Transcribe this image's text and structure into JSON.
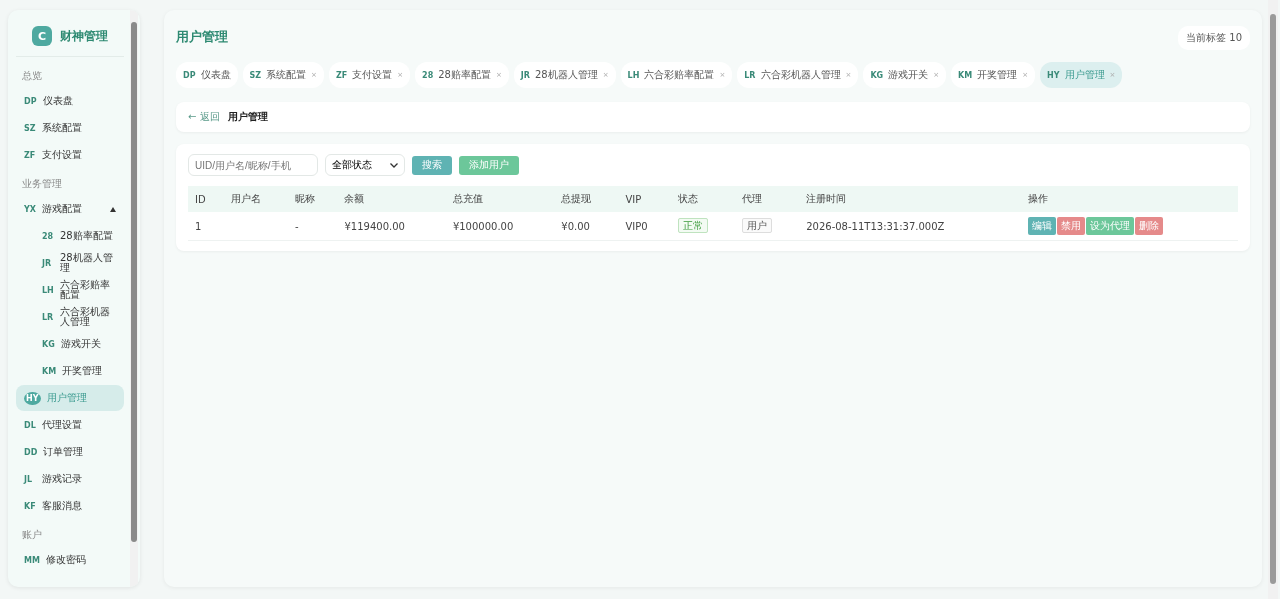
{
  "sidebar": {
    "logo_letter": "C",
    "brand": "财神管理",
    "sections": [
      {
        "title": "总览",
        "items": [
          {
            "code": "DP",
            "label": "仪表盘",
            "selected": false
          },
          {
            "code": "SZ",
            "label": "系统配置",
            "selected": false
          },
          {
            "code": "ZF",
            "label": "支付设置",
            "selected": false
          }
        ]
      },
      {
        "title": "业务管理",
        "items": [
          {
            "code": "YX",
            "label": "游戏配置",
            "selected": false,
            "expanded": true,
            "children": [
              {
                "code": "28",
                "label": "28赔率配置",
                "selected": false
              },
              {
                "code": "JR",
                "label": "28机器人管理",
                "selected": false
              },
              {
                "code": "LH",
                "label": "六合彩赔率配置",
                "selected": false
              },
              {
                "code": "LR",
                "label": "六合彩机器人管理",
                "selected": false
              },
              {
                "code": "KG",
                "label": "游戏开关",
                "selected": false
              },
              {
                "code": "KM",
                "label": "开奖管理",
                "selected": false
              }
            ]
          },
          {
            "code": "HY",
            "label": "用户管理",
            "selected": true
          },
          {
            "code": "DL",
            "label": "代理设置",
            "selected": false
          },
          {
            "code": "DD",
            "label": "订单管理",
            "selected": false
          },
          {
            "code": "JL",
            "label": "游戏记录",
            "selected": false
          },
          {
            "code": "KF",
            "label": "客服消息",
            "selected": false
          }
        ]
      },
      {
        "title": "账户",
        "items": [
          {
            "code": "MM",
            "label": "修改密码",
            "selected": false
          }
        ]
      }
    ]
  },
  "header": {
    "title": "用户管理",
    "tab_count": "当前标签 10"
  },
  "tabs": [
    {
      "code": "DP",
      "label": "仪表盘",
      "closable": false,
      "selected": false
    },
    {
      "code": "SZ",
      "label": "系统配置",
      "closable": true,
      "selected": false
    },
    {
      "code": "ZF",
      "label": "支付设置",
      "closable": true,
      "selected": false
    },
    {
      "code": "28",
      "label": "28赔率配置",
      "closable": true,
      "selected": false
    },
    {
      "code": "JR",
      "label": "28机器人管理",
      "closable": true,
      "selected": false
    },
    {
      "code": "LH",
      "label": "六合彩赔率配置",
      "closable": true,
      "selected": false
    },
    {
      "code": "LR",
      "label": "六合彩机器人管理",
      "closable": true,
      "selected": false
    },
    {
      "code": "KG",
      "label": "游戏开关",
      "closable": true,
      "selected": false
    },
    {
      "code": "KM",
      "label": "开奖管理",
      "closable": true,
      "selected": false
    },
    {
      "code": "HY",
      "label": "用户管理",
      "closable": true,
      "selected": true
    }
  ],
  "tab_close": "×",
  "breadcrumb": {
    "back": "← 返回",
    "title": "用户管理"
  },
  "filters": {
    "search_placeholder": "UID/用户名/昵称/手机",
    "status_value": "全部状态",
    "search_button": "搜索",
    "add_button": "添加用户"
  },
  "table": {
    "columns": [
      "ID",
      "用户名",
      "昵称",
      "余额",
      "总充值",
      "总提现",
      "VIP",
      "状态",
      "代理",
      "注册时间",
      "操作"
    ],
    "rows": [
      {
        "id": "1",
        "username": "",
        "nickname": "-",
        "balance": "¥119400.00",
        "total_recharge": "¥100000.00",
        "total_withdraw": "¥0.00",
        "vip": "VIP0",
        "status": "正常",
        "agent": "用户",
        "registered": "2026-08-11T13:31:37.000Z",
        "actions": [
          {
            "kind": "edit",
            "label": "编辑"
          },
          {
            "kind": "disable",
            "label": "禁用"
          },
          {
            "kind": "agent",
            "label": "设为代理"
          },
          {
            "kind": "delete",
            "label": "删除"
          }
        ]
      }
    ]
  }
}
